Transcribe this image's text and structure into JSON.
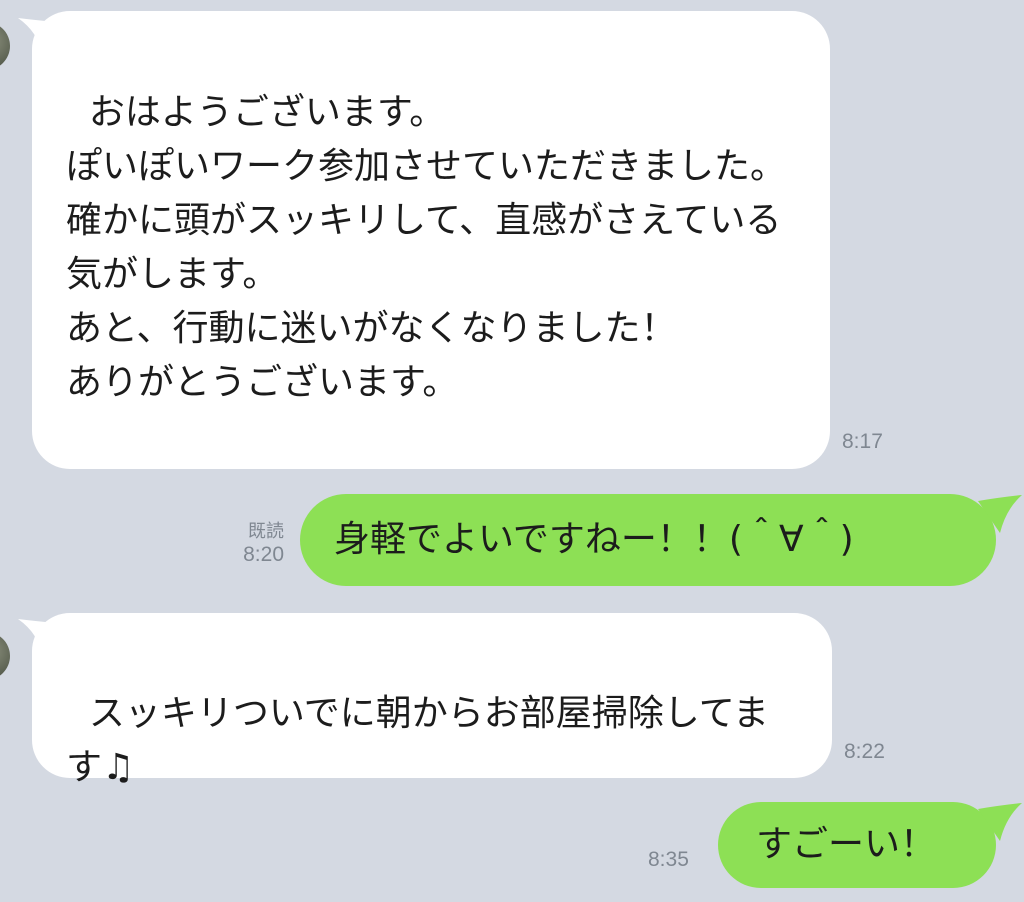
{
  "messages": [
    {
      "sender": "contact",
      "text": "おはようございます。\nぽいぽいワーク参加させていただきました。\n確かに頭がスッキリして、直感がさえている気がします。\nあと、行動に迷いがなくなりました！\nありがとうございます。",
      "time": "8:17"
    },
    {
      "sender": "me",
      "text": "身軽でよいですねー！！(＾∀＾)",
      "status": "既読",
      "time": "8:20"
    },
    {
      "sender": "contact",
      "text": "スッキリついでに朝からお部屋掃除してます♫",
      "time": "8:22"
    },
    {
      "sender": "me",
      "text": "すごーい！",
      "time": "8:35"
    }
  ],
  "colors": {
    "background": "#d4d9e2",
    "incoming_bubble": "#ffffff",
    "outgoing_bubble": "#8de055",
    "timestamp": "#7f8791"
  }
}
